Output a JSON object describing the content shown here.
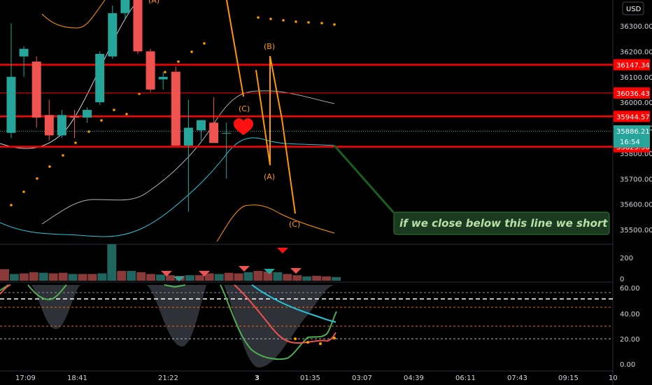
{
  "currency": "USD",
  "countdown": "16:54",
  "colors": {
    "up": "#26a69a",
    "down": "#ef5350",
    "level": "#ff0000",
    "wave": "#ff9800",
    "note_bg": "#1b5e20",
    "sar": "#ff9800"
  },
  "chart_data": {
    "type": "candlestick",
    "price_axis": {
      "ylim": [
        35440,
        36420
      ],
      "ticks": [
        "36300.00",
        "36200.00",
        "36100.00",
        "36000.00",
        "35900.00",
        "35800.00",
        "35700.00",
        "35600.00",
        "35500.00"
      ]
    },
    "time_axis": {
      "labels": [
        "17:09",
        "18:41",
        "21:22",
        "3",
        "01:35",
        "03:07",
        "04:39",
        "06:11",
        "07:43",
        "09:15",
        "10"
      ]
    },
    "levels": [
      {
        "price": 36147.34,
        "label": "36147.34",
        "style": "thick"
      },
      {
        "price": 36036.43,
        "label": "36036.43",
        "style": "thin"
      },
      {
        "price": 35944.57,
        "label": "35944.57",
        "style": "thick"
      },
      {
        "price": 35825.5,
        "label": "35825.50",
        "style": "thick"
      }
    ],
    "last_price": {
      "price": 35886.21,
      "label": "35886.21"
    },
    "candles": [
      {
        "o": 35880,
        "h": 36310,
        "l": 35860,
        "c": 36100
      },
      {
        "o": 36180,
        "h": 36220,
        "l": 36100,
        "c": 36210
      },
      {
        "o": 36160,
        "h": 36180,
        "l": 35900,
        "c": 35940
      },
      {
        "o": 35950,
        "h": 36010,
        "l": 35850,
        "c": 35870
      },
      {
        "o": 35870,
        "h": 35970,
        "l": 35860,
        "c": 35950
      },
      {
        "o": 35945,
        "h": 35970,
        "l": 35860,
        "c": 35940
      },
      {
        "o": 35940,
        "h": 35980,
        "l": 35920,
        "c": 35970
      },
      {
        "o": 36000,
        "h": 36200,
        "l": 35990,
        "c": 36190
      },
      {
        "o": 36180,
        "h": 36380,
        "l": 36170,
        "c": 36350
      },
      {
        "o": 36350,
        "h": 36450,
        "l": 36330,
        "c": 36440
      },
      {
        "o": 36410,
        "h": 36450,
        "l": 36190,
        "c": 36200
      },
      {
        "o": 36200,
        "h": 36210,
        "l": 36040,
        "c": 36050
      },
      {
        "o": 36090,
        "h": 36120,
        "l": 36050,
        "c": 36100
      },
      {
        "o": 36120,
        "h": 36140,
        "l": 35830,
        "c": 35830
      },
      {
        "o": 35830,
        "h": 36010,
        "l": 35570,
        "c": 35900
      },
      {
        "o": 35890,
        "h": 35930,
        "l": 35850,
        "c": 35930
      },
      {
        "o": 35920,
        "h": 36020,
        "l": 35840,
        "c": 35840
      },
      {
        "o": 35880,
        "h": 35920,
        "l": 35700,
        "c": 35880
      }
    ],
    "volume": {
      "ticks": [
        "200",
        "0"
      ],
      "ylim": [
        0,
        310
      ]
    },
    "oscillator": {
      "ticks": [
        "60.00",
        "40.00",
        "20.00",
        "0.00"
      ],
      "ylim": [
        -2,
        62
      ]
    },
    "annotations": {
      "wave_labels": [
        "(C)",
        "(B)",
        "(A)",
        "(C)"
      ],
      "note": "if we close below this line we short"
    }
  }
}
